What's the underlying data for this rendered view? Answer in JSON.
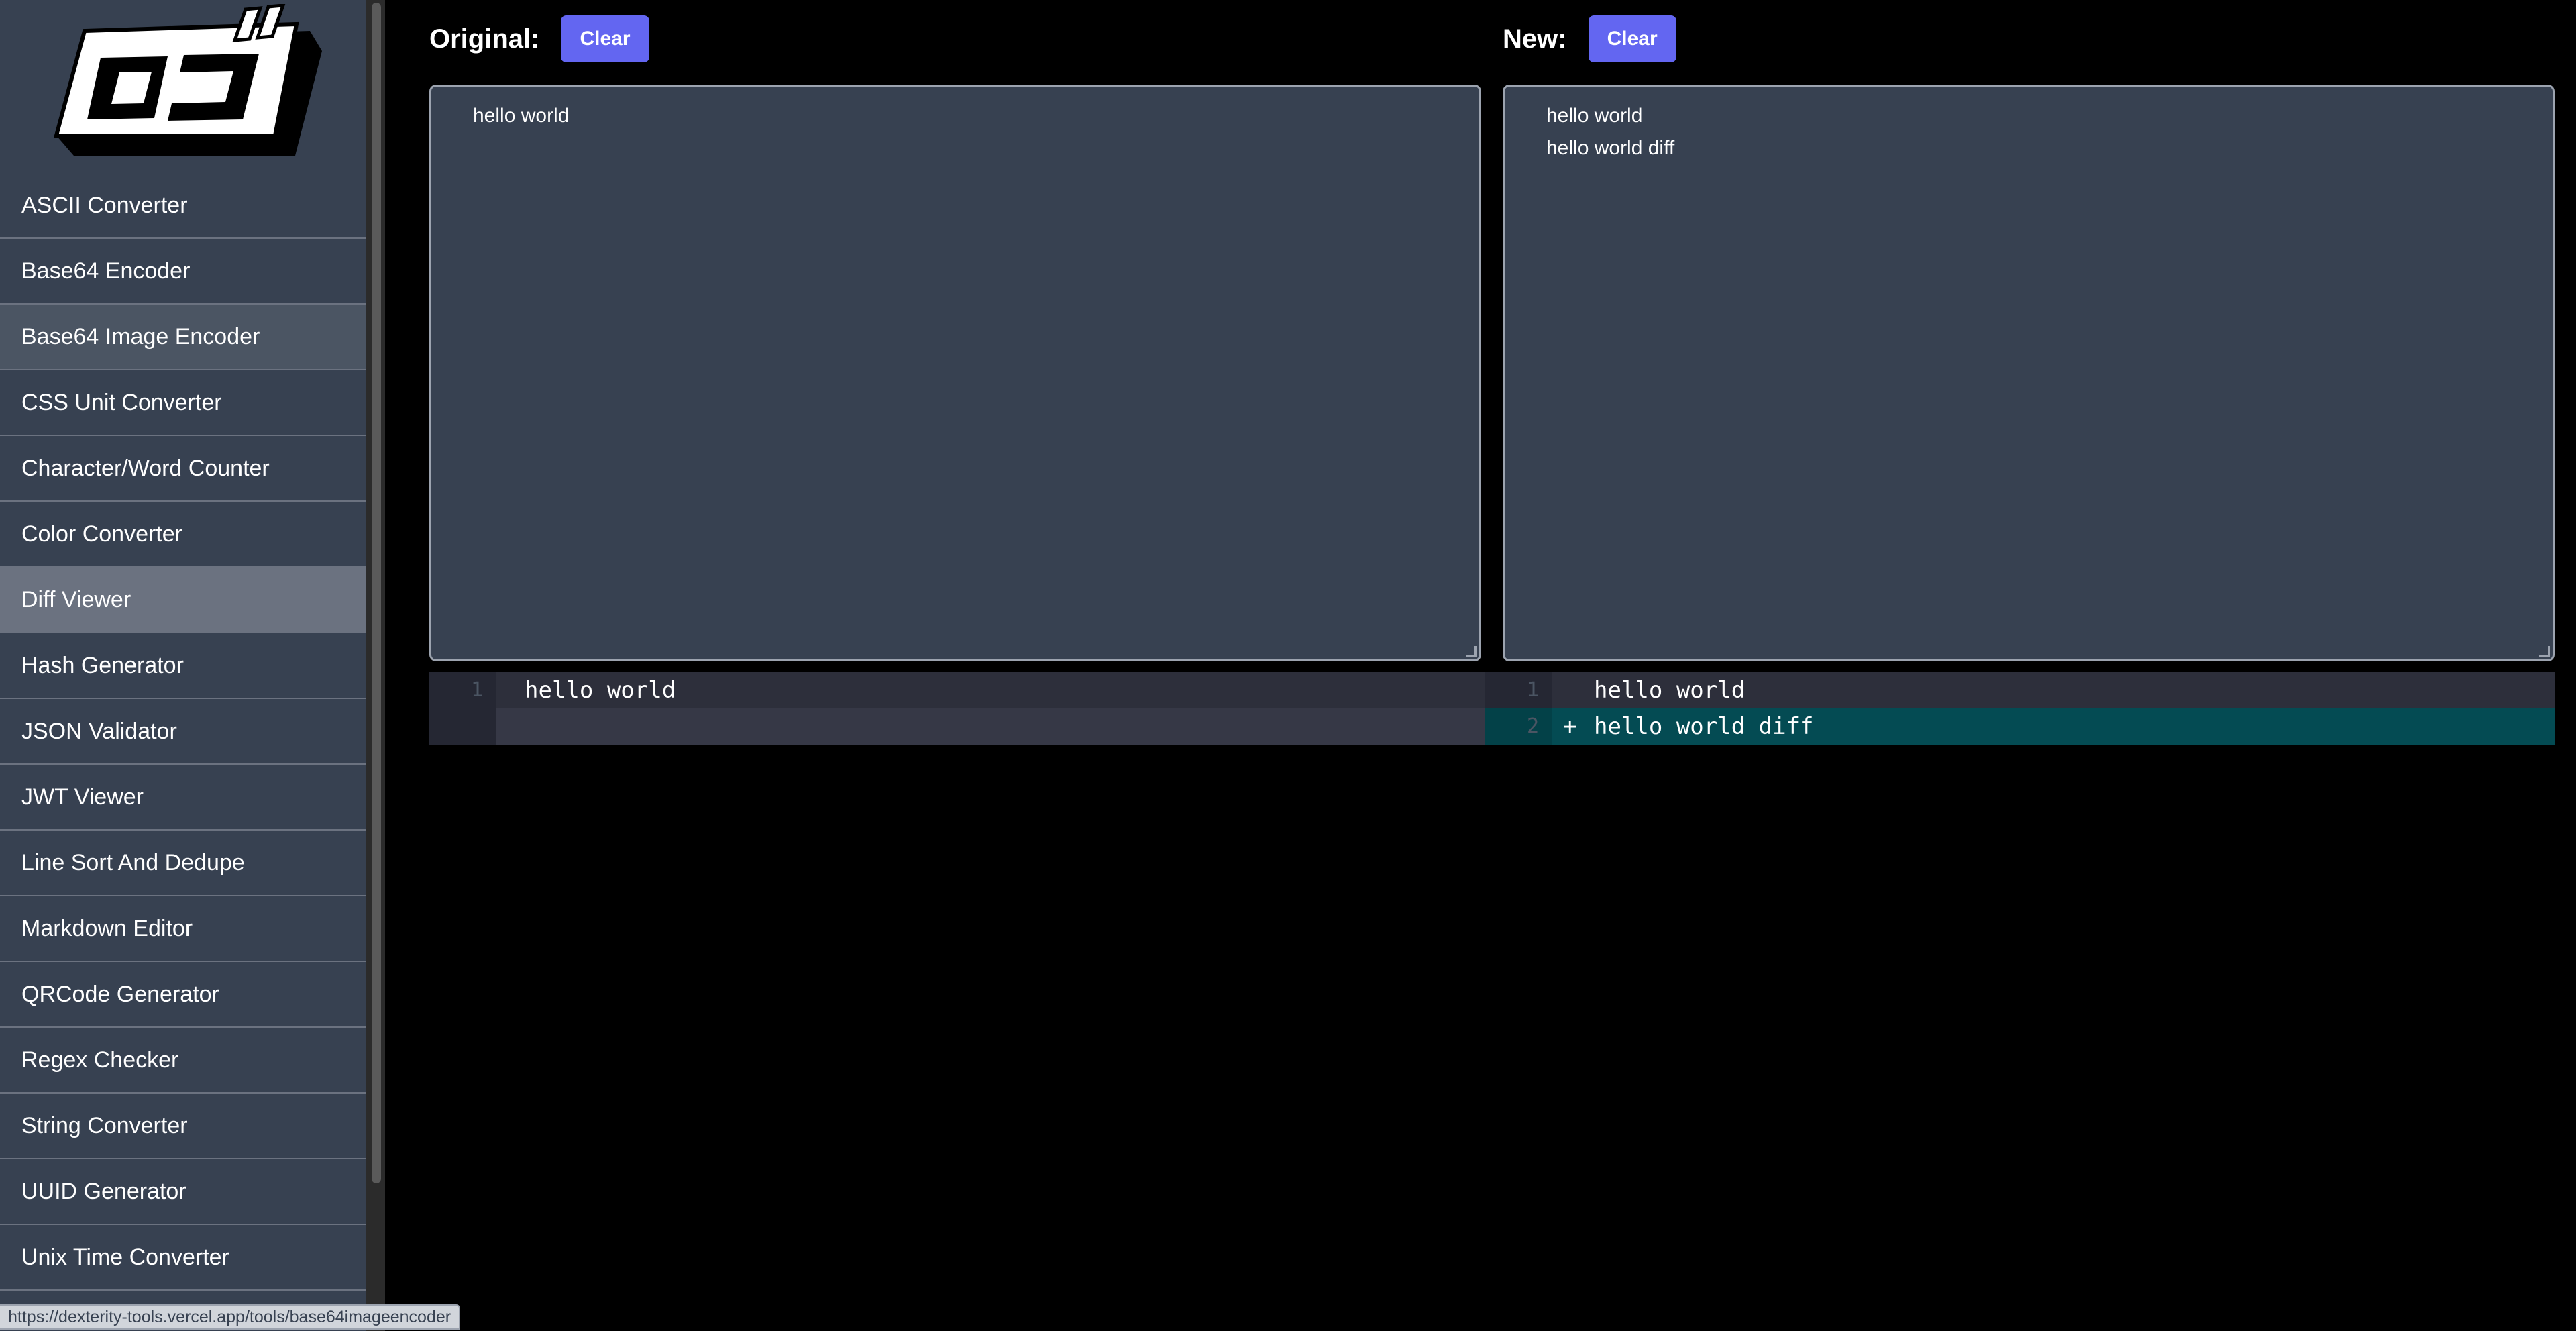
{
  "sidebar": {
    "logo_alt": "ロゴ",
    "items": [
      {
        "label": "ASCII Converter",
        "state": "normal"
      },
      {
        "label": "Base64 Encoder",
        "state": "normal"
      },
      {
        "label": "Base64 Image Encoder",
        "state": "hover"
      },
      {
        "label": "CSS Unit Converter",
        "state": "normal"
      },
      {
        "label": "Character/Word Counter",
        "state": "normal"
      },
      {
        "label": "Color Converter",
        "state": "normal"
      },
      {
        "label": "Diff Viewer",
        "state": "active"
      },
      {
        "label": "Hash Generator",
        "state": "normal"
      },
      {
        "label": "JSON Validator",
        "state": "normal"
      },
      {
        "label": "JWT Viewer",
        "state": "normal"
      },
      {
        "label": "Line Sort And Dedupe",
        "state": "normal"
      },
      {
        "label": "Markdown Editor",
        "state": "normal"
      },
      {
        "label": "QRCode Generator",
        "state": "normal"
      },
      {
        "label": "Regex Checker",
        "state": "normal"
      },
      {
        "label": "String Converter",
        "state": "normal"
      },
      {
        "label": "UUID Generator",
        "state": "normal"
      },
      {
        "label": "Unix Time Converter",
        "state": "normal"
      }
    ]
  },
  "status_url": "https://dexterity-tools.vercel.app/tools/base64imageencoder",
  "original": {
    "title": "Original:",
    "clear_label": "Clear",
    "lines": [
      "hello world"
    ]
  },
  "new": {
    "title": "New:",
    "clear_label": "Clear",
    "lines": [
      "hello world",
      "hello world diff"
    ]
  },
  "diff": {
    "left": [
      {
        "num": "1",
        "text": "hello world",
        "type": "unchanged"
      },
      {
        "num": "",
        "text": "",
        "type": "empty"
      }
    ],
    "right": [
      {
        "num": "1",
        "marker": "",
        "text": "hello world",
        "type": "unchanged"
      },
      {
        "num": "2",
        "marker": "+",
        "text": "hello world diff",
        "type": "added"
      }
    ]
  },
  "colors": {
    "sidebar_bg": "#374151",
    "nav_hover": "#4b5563",
    "nav_active": "#6b7280",
    "button_accent": "#6366f1",
    "editor_bg": "#374151",
    "diff_unchanged_bg": "#2d2f3b",
    "diff_gutter_bg": "#252733",
    "diff_empty_bg": "#363846",
    "diff_added_bg": "#044b53",
    "diff_added_gutter_bg": "#034148"
  }
}
